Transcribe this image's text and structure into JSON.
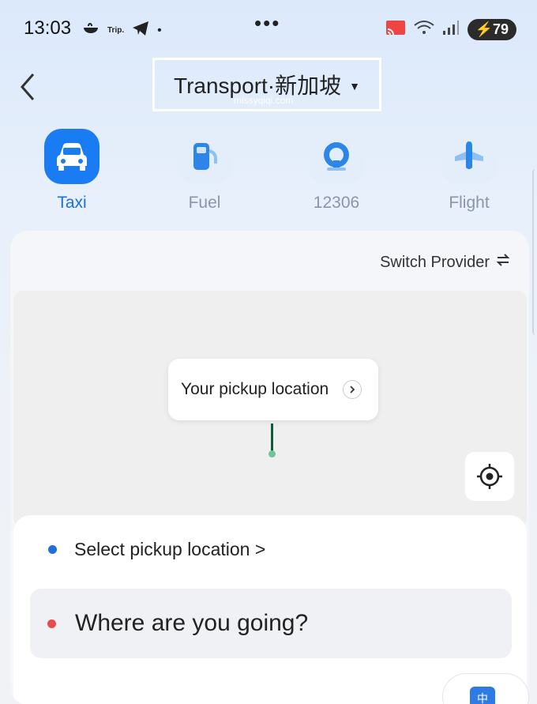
{
  "status_bar": {
    "time": "13:03",
    "trip_label": "Trip.",
    "battery": "79"
  },
  "header": {
    "title": "Transport·新加坡",
    "watermark": "missyqiqi.com"
  },
  "categories": [
    {
      "label": "Taxi",
      "icon": "taxi-icon",
      "active": true
    },
    {
      "label": "Fuel",
      "icon": "fuel-icon",
      "active": false
    },
    {
      "label": "12306",
      "icon": "train-icon",
      "active": false
    },
    {
      "label": "Flight",
      "icon": "flight-icon",
      "active": false
    }
  ],
  "switch_provider": {
    "label": "Switch Provider"
  },
  "map": {
    "pickup_bubble": "Your pickup location"
  },
  "route": {
    "pickup_label": "Select pickup location >",
    "destination_placeholder": "Where are you going?"
  },
  "fab": {
    "glyph": "中"
  },
  "colors": {
    "accent": "#1a7cf2",
    "pickup_dot": "#1f6fd8",
    "destination_dot": "#e84b4b"
  }
}
